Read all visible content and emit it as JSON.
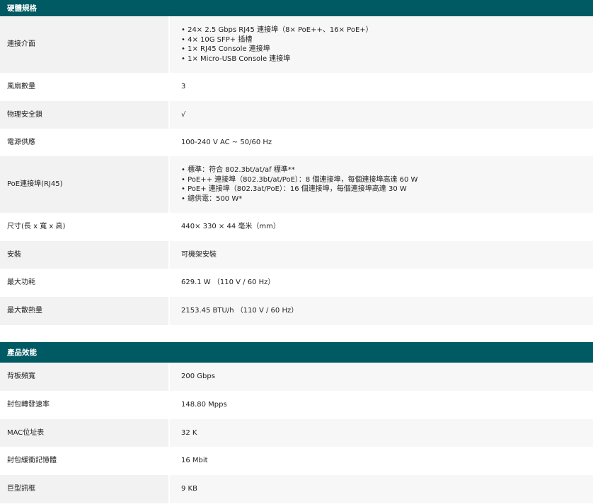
{
  "hardware": {
    "title": "硬體規格",
    "rows": [
      {
        "label": "連接介面",
        "items": [
          "24× 2.5 Gbps RJ45 連接埠（8× PoE++、16× PoE+）",
          "4× 10G SFP+ 插槽",
          "1× RJ45 Console 連接埠",
          "1× Micro-USB Console 連接埠"
        ]
      },
      {
        "label": "風扇數量",
        "value": "3"
      },
      {
        "label": "物理安全鎖",
        "value": "√"
      },
      {
        "label": "電源供應",
        "value": "100-240 V AC ~ 50/60 Hz"
      },
      {
        "label": "PoE連接埠(RJ45)",
        "items": [
          "標準：符合 802.3bt/at/af 標準**",
          "PoE++ 連接埠（802.3bt/at/PoE）：8 個連接埠，每個連接埠高達 60 W",
          "PoE+ 連接埠（802.3at/PoE）：16 個連接埠，每個連接埠高達 30 W",
          "總供電：500 W*"
        ]
      },
      {
        "label": "尺寸(長 x 寬 x 高)",
        "value": "440× 330 × 44 毫米（mm）"
      },
      {
        "label": "安裝",
        "value": "可機架安裝"
      },
      {
        "label": "最大功耗",
        "value": "629.1 W （110 V / 60 Hz）"
      },
      {
        "label": "最大散熱量",
        "value": "2153.45 BTU/h （110 V / 60 Hz）"
      }
    ]
  },
  "performance": {
    "title": "產品效能",
    "rows": [
      {
        "label": "背板頻寬",
        "value": "200 Gbps"
      },
      {
        "label": "封包轉發速率",
        "value": "148.80 Mpps"
      },
      {
        "label": "MAC位址表",
        "value": "32 K"
      },
      {
        "label": "封包緩衝記憶體",
        "value": "16 Mbit"
      },
      {
        "label": "巨型訊框",
        "value": "9 KB"
      }
    ]
  }
}
